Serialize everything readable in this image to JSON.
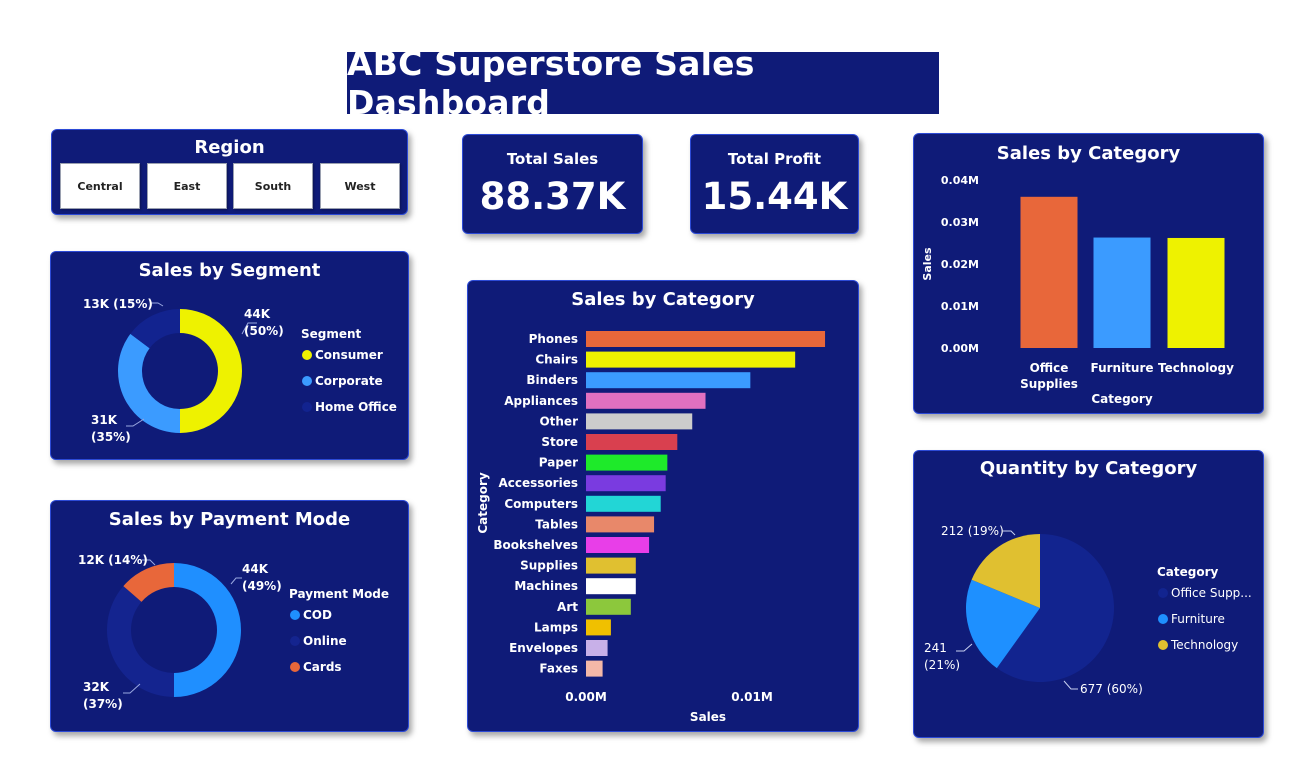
{
  "header": {
    "title": "ABC Superstore Sales Dashboard"
  },
  "colors": {
    "background": "#ffffff",
    "card": "#0f1b78",
    "card_border": "#2c4ad6"
  },
  "region_slicer": {
    "title": "Region",
    "options": [
      "Central",
      "East",
      "South",
      "West"
    ]
  },
  "kpis": {
    "total_sales": {
      "label": "Total Sales",
      "value": "88.37K"
    },
    "total_profit": {
      "label": "Total Profit",
      "value": "15.44K"
    }
  },
  "chart_data": [
    {
      "id": "segment",
      "type": "pie",
      "variant": "donut",
      "title": "Sales by Segment",
      "legend_title": "Segment",
      "slices": [
        {
          "name": "Consumer",
          "value": 44,
          "percent": 50,
          "label": "44K (50%)",
          "color": "#eef200"
        },
        {
          "name": "Corporate",
          "value": 31,
          "percent": 35,
          "label": "31K (35%)",
          "color": "#3b9bff"
        },
        {
          "name": "Home Office",
          "value": 13,
          "percent": 15,
          "label": "13K (15%)",
          "color": "#12238f"
        }
      ]
    },
    {
      "id": "payment",
      "type": "pie",
      "variant": "donut",
      "title": "Sales by Payment Mode",
      "legend_title": "Payment Mode",
      "slices": [
        {
          "name": "COD",
          "value": 44,
          "percent": 49,
          "label": "44K (49%)",
          "color": "#1f8fff"
        },
        {
          "name": "Online",
          "value": 32,
          "percent": 37,
          "label": "32K (37%)",
          "color": "#14248f"
        },
        {
          "name": "Cards",
          "value": 12,
          "percent": 14,
          "label": "12K (14%)",
          "color": "#e8673a"
        }
      ]
    },
    {
      "id": "subcategory",
      "type": "bar",
      "orientation": "horizontal",
      "title": "Sales by Category",
      "xlabel": "Sales",
      "ylabel": "Category",
      "xticks": [
        "0.00M",
        "0.01M"
      ],
      "xlim": [
        0,
        0.015
      ],
      "categories": [
        "Phones",
        "Chairs",
        "Binders",
        "Appliances",
        "Other",
        "Store",
        "Paper",
        "Accessories",
        "Computers",
        "Tables",
        "Bookshelves",
        "Supplies",
        "Machines",
        "Art",
        "Lamps",
        "Envelopes",
        "Faxes"
      ],
      "values": [
        0.0144,
        0.0126,
        0.0099,
        0.0072,
        0.0064,
        0.0055,
        0.0049,
        0.0048,
        0.0045,
        0.0041,
        0.0038,
        0.003,
        0.003,
        0.0027,
        0.0015,
        0.0013,
        0.001
      ],
      "colors": [
        "#e8673a",
        "#eef200",
        "#3b9bff",
        "#e070c0",
        "#cccccc",
        "#d9404f",
        "#1eea2a",
        "#7a3be0",
        "#22d6d6",
        "#e8886a",
        "#e83ee8",
        "#e0c030",
        "#ffffff",
        "#8cc83c",
        "#f0c000",
        "#c8b0e8",
        "#f4b8a8"
      ]
    },
    {
      "id": "category",
      "type": "bar",
      "orientation": "vertical",
      "title": "Sales by Category",
      "xlabel": "Category",
      "ylabel": "Sales",
      "yticks": [
        "0.04M",
        "0.03M",
        "0.02M",
        "0.01M",
        "0.00M"
      ],
      "ylim": [
        0,
        0.04
      ],
      "categories": [
        "Office Supplies",
        "Furniture",
        "Technology"
      ],
      "category_lines": [
        [
          "Office",
          "Supplies"
        ],
        [
          "Furniture"
        ],
        [
          "Technology"
        ]
      ],
      "values": [
        0.036,
        0.0263,
        0.0262
      ],
      "colors": [
        "#e8673a",
        "#3b9bff",
        "#eef200"
      ]
    },
    {
      "id": "quantity",
      "type": "pie",
      "title": "Quantity by Category",
      "legend_title": "Category",
      "slices": [
        {
          "name": "Office Supp...",
          "value": 677,
          "percent": 60,
          "label": "677 (60%)",
          "color": "#12248f"
        },
        {
          "name": "Furniture",
          "value": 241,
          "percent": 21,
          "label": "241 (21%)",
          "color": "#1e90ff"
        },
        {
          "name": "Technology",
          "value": 212,
          "percent": 19,
          "label": "212 (19%)",
          "color": "#e0c030"
        }
      ]
    }
  ]
}
